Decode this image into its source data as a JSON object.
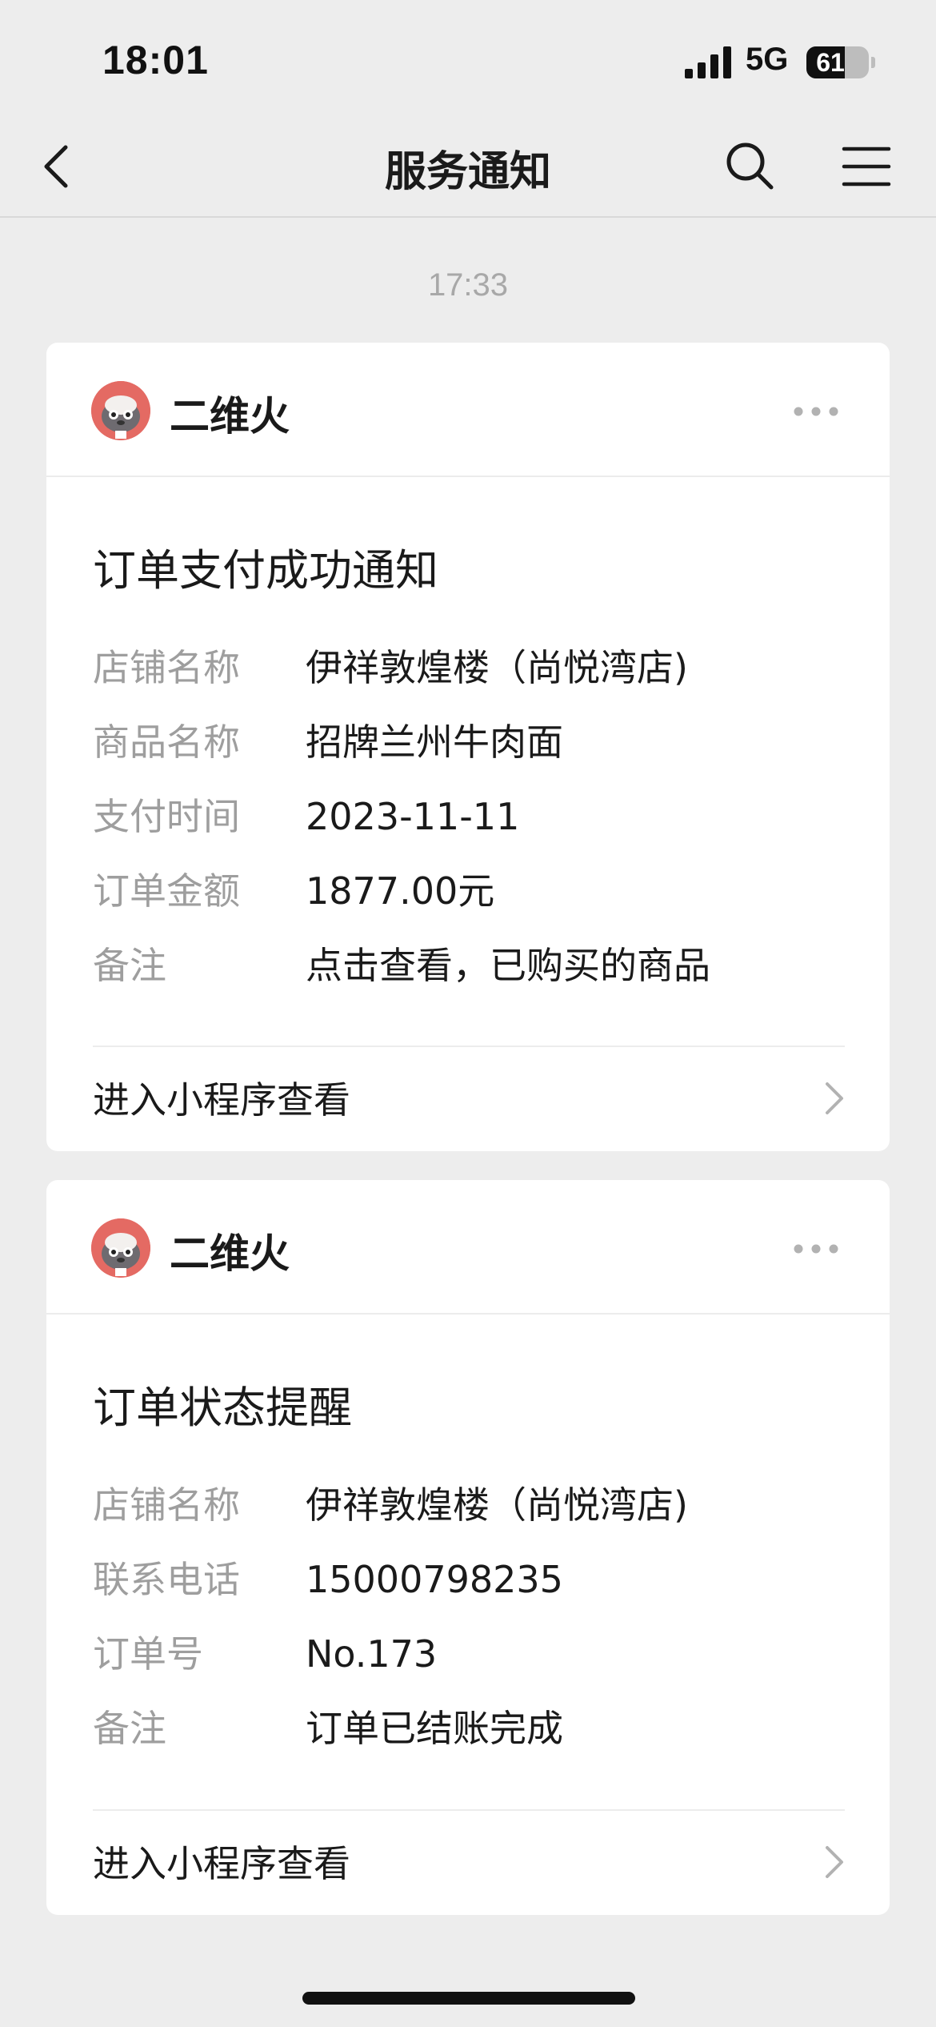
{
  "status_bar": {
    "time": "18:01",
    "network": "5G",
    "battery": "61",
    "battery_level": 0.61
  },
  "nav": {
    "title": "服务通知",
    "back_icon": "chevron-left-icon",
    "search_icon": "search-icon",
    "menu_icon": "hamburger-menu-icon"
  },
  "timestamp": "17:33",
  "cards": [
    {
      "sender": "二维火",
      "title": "订单支付成功通知",
      "fields": [
        {
          "label": "店铺名称",
          "value": "伊祥敦煌楼（尚悦湾店)"
        },
        {
          "label": "商品名称",
          "value": "招牌兰州牛肉面"
        },
        {
          "label": "支付时间",
          "value": "2023-11-11"
        },
        {
          "label": "订单金额",
          "value": "1877.00元"
        },
        {
          "label": "备注",
          "value": "点击查看，已购买的商品"
        }
      ],
      "link_label": "进入小程序查看"
    },
    {
      "sender": "二维火",
      "title": "订单状态提醒",
      "fields": [
        {
          "label": "店铺名称",
          "value": "伊祥敦煌楼（尚悦湾店)"
        },
        {
          "label": "联系电话",
          "value": "15000798235"
        },
        {
          "label": "订单号",
          "value": "No.173"
        },
        {
          "label": "备注",
          "value": "订单已结账完成"
        }
      ],
      "link_label": "进入小程序查看"
    }
  ],
  "colors": {
    "background": "#ededed",
    "card": "#ffffff",
    "label": "#9e9e9e",
    "text": "#1a1a1a",
    "avatar": "#e46a63"
  }
}
